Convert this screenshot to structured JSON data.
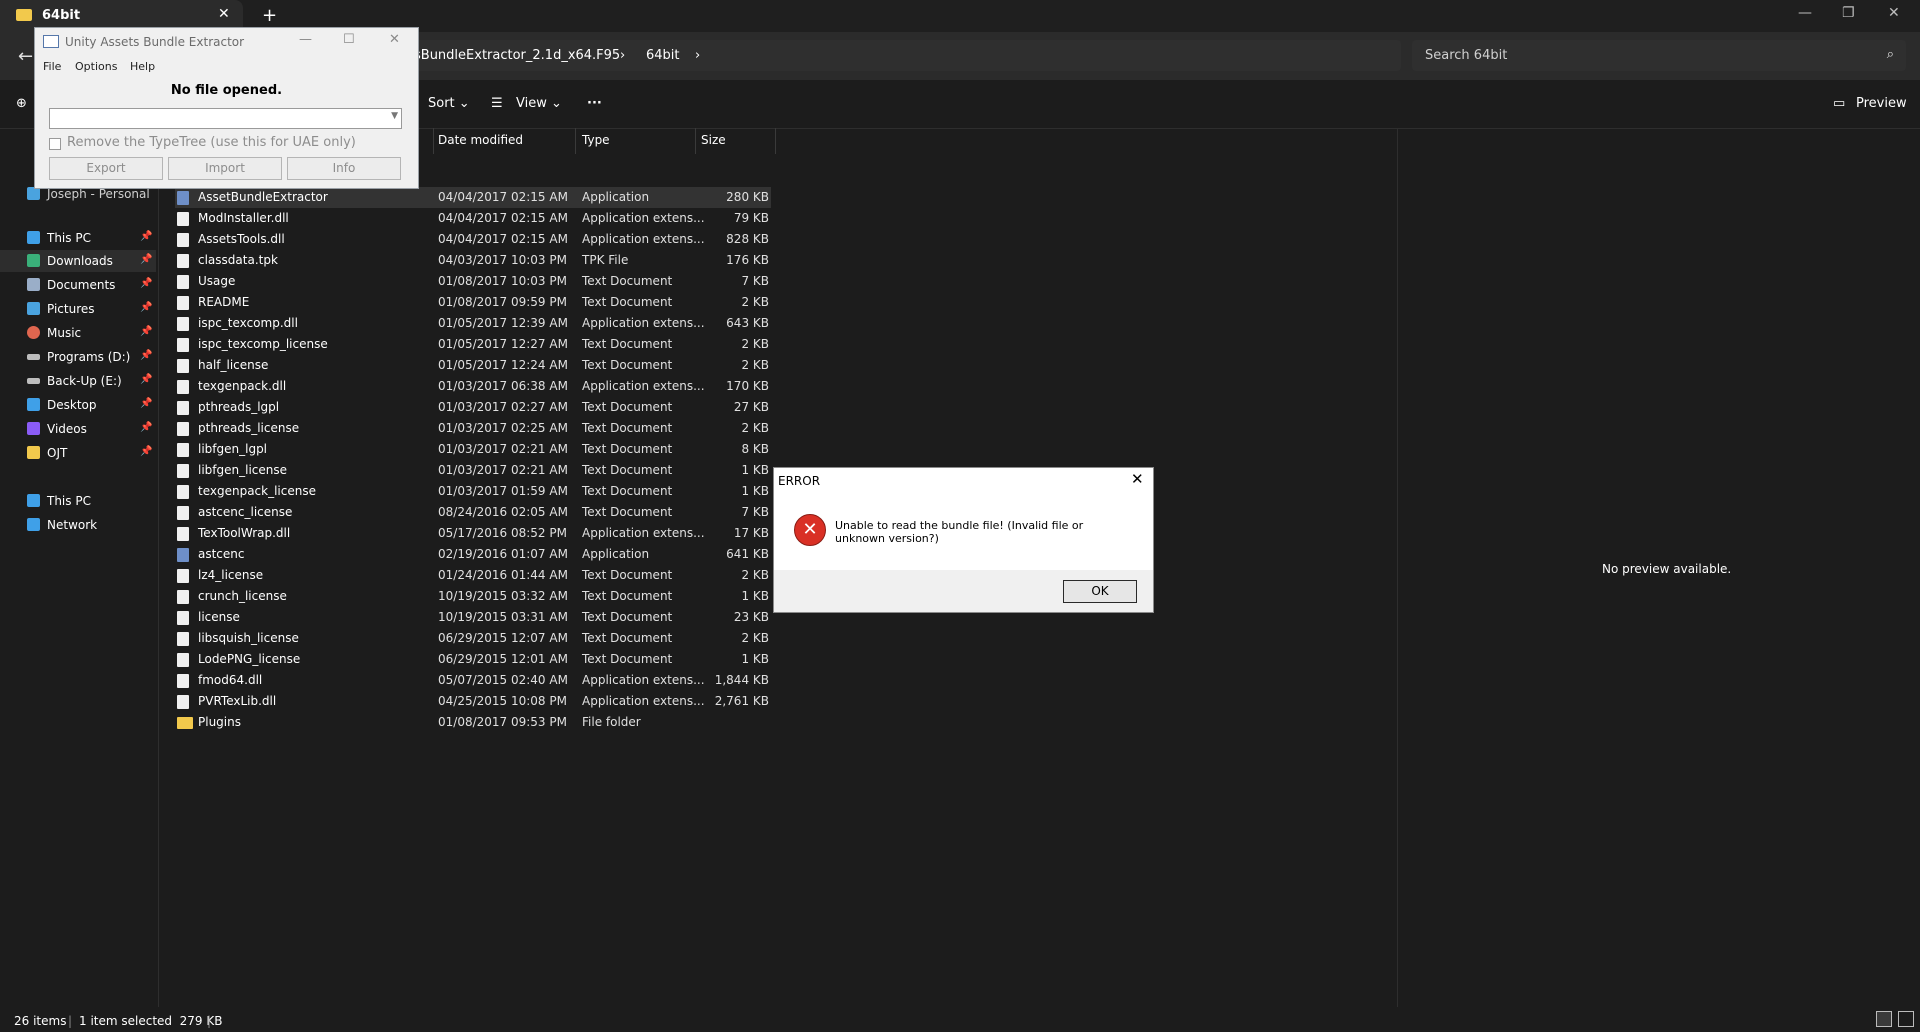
{
  "explorer": {
    "tab_title": "64bit",
    "tab_close": "✕",
    "new_tab": "+",
    "breadcrumb": [
      "sBundleExtractor_2.1d_x64.F95",
      "64bit"
    ],
    "search_placeholder": "Search 64bit",
    "toolbar": {
      "sort": "Sort",
      "view": "View",
      "more": "···",
      "preview": "Preview"
    },
    "columns": {
      "date": "Date modified",
      "type": "Type",
      "size": "Size"
    },
    "nav": [
      {
        "label": "Joseph - Personal",
        "icon": "cloud-icon",
        "color": "#4aa3df"
      },
      {
        "label": "This PC",
        "icon": "pc-icon",
        "color": "#3fa0e8"
      },
      {
        "label": "Downloads",
        "icon": "download-icon",
        "color": "#3ab07a"
      },
      {
        "label": "Documents",
        "icon": "documents-icon",
        "color": "#9aaec8"
      },
      {
        "label": "Pictures",
        "icon": "pictures-icon",
        "color": "#4aa3df"
      },
      {
        "label": "Music",
        "icon": "music-icon",
        "color": "#e0664f"
      },
      {
        "label": "Programs (D:)",
        "icon": "drive-icon",
        "color": "#bdbdbd"
      },
      {
        "label": "Back-Up (E:)",
        "icon": "drive-icon",
        "color": "#bdbdbd"
      },
      {
        "label": "Desktop",
        "icon": "desktop-icon",
        "color": "#3fa0e8"
      },
      {
        "label": "Videos",
        "icon": "videos-icon",
        "color": "#8b5cf6"
      },
      {
        "label": "OJT",
        "icon": "folder-icon",
        "color": "#f2c94c"
      },
      {
        "label": "This PC",
        "icon": "pc-icon",
        "color": "#3fa0e8"
      },
      {
        "label": "Network",
        "icon": "network-icon",
        "color": "#3fa0e8"
      }
    ],
    "files": [
      {
        "name": "AssetBundleExtractor",
        "date": "04/04/2017 02:15 AM",
        "type": "Application",
        "size": "280 KB",
        "kind": "app"
      },
      {
        "name": "ModInstaller.dll",
        "date": "04/04/2017 02:15 AM",
        "type": "Application extens...",
        "size": "79 KB",
        "kind": "file"
      },
      {
        "name": "AssetsTools.dll",
        "date": "04/04/2017 02:15 AM",
        "type": "Application extens...",
        "size": "828 KB",
        "kind": "file"
      },
      {
        "name": "classdata.tpk",
        "date": "04/03/2017 10:03 PM",
        "type": "TPK File",
        "size": "176 KB",
        "kind": "file"
      },
      {
        "name": "Usage",
        "date": "01/08/2017 10:03 PM",
        "type": "Text Document",
        "size": "7 KB",
        "kind": "file"
      },
      {
        "name": "README",
        "date": "01/08/2017 09:59 PM",
        "type": "Text Document",
        "size": "2 KB",
        "kind": "file"
      },
      {
        "name": "ispc_texcomp.dll",
        "date": "01/05/2017 12:39 AM",
        "type": "Application extens...",
        "size": "643 KB",
        "kind": "file"
      },
      {
        "name": "ispc_texcomp_license",
        "date": "01/05/2017 12:27 AM",
        "type": "Text Document",
        "size": "2 KB",
        "kind": "file"
      },
      {
        "name": "half_license",
        "date": "01/05/2017 12:24 AM",
        "type": "Text Document",
        "size": "2 KB",
        "kind": "file"
      },
      {
        "name": "texgenpack.dll",
        "date": "01/03/2017 06:38 AM",
        "type": "Application extens...",
        "size": "170 KB",
        "kind": "file"
      },
      {
        "name": "pthreads_lgpl",
        "date": "01/03/2017 02:27 AM",
        "type": "Text Document",
        "size": "27 KB",
        "kind": "file"
      },
      {
        "name": "pthreads_license",
        "date": "01/03/2017 02:25 AM",
        "type": "Text Document",
        "size": "2 KB",
        "kind": "file"
      },
      {
        "name": "libfgen_lgpl",
        "date": "01/03/2017 02:21 AM",
        "type": "Text Document",
        "size": "8 KB",
        "kind": "file"
      },
      {
        "name": "libfgen_license",
        "date": "01/03/2017 02:21 AM",
        "type": "Text Document",
        "size": "1 KB",
        "kind": "file"
      },
      {
        "name": "texgenpack_license",
        "date": "01/03/2017 01:59 AM",
        "type": "Text Document",
        "size": "1 KB",
        "kind": "file"
      },
      {
        "name": "astcenc_license",
        "date": "08/24/2016 02:05 AM",
        "type": "Text Document",
        "size": "7 KB",
        "kind": "file"
      },
      {
        "name": "TexToolWrap.dll",
        "date": "05/17/2016 08:52 PM",
        "type": "Application extens...",
        "size": "17 KB",
        "kind": "file"
      },
      {
        "name": "astcenc",
        "date": "02/19/2016 01:07 AM",
        "type": "Application",
        "size": "641 KB",
        "kind": "app"
      },
      {
        "name": "lz4_license",
        "date": "01/24/2016 01:44 AM",
        "type": "Text Document",
        "size": "2 KB",
        "kind": "file"
      },
      {
        "name": "crunch_license",
        "date": "10/19/2015 03:32 AM",
        "type": "Text Document",
        "size": "1 KB",
        "kind": "file"
      },
      {
        "name": "license",
        "date": "10/19/2015 03:31 AM",
        "type": "Text Document",
        "size": "23 KB",
        "kind": "file"
      },
      {
        "name": "libsquish_license",
        "date": "06/29/2015 12:07 AM",
        "type": "Text Document",
        "size": "2 KB",
        "kind": "file"
      },
      {
        "name": "LodePNG_license",
        "date": "06/29/2015 12:01 AM",
        "type": "Text Document",
        "size": "1 KB",
        "kind": "file"
      },
      {
        "name": "fmod64.dll",
        "date": "05/07/2015 02:40 AM",
        "type": "Application extens...",
        "size": "1,844 KB",
        "kind": "file"
      },
      {
        "name": "PVRTexLib.dll",
        "date": "04/25/2015 10:08 PM",
        "type": "Application extens...",
        "size": "2,761 KB",
        "kind": "file"
      },
      {
        "name": "Plugins",
        "date": "01/08/2017 09:53 PM",
        "type": "File folder",
        "size": "",
        "kind": "folder"
      }
    ],
    "preview_empty": "No preview available.",
    "status": {
      "items": "26 items",
      "selected": "1 item selected  279 KB"
    }
  },
  "uabe": {
    "title": "Unity Assets Bundle Extractor",
    "menu": [
      "File",
      "Options",
      "Help"
    ],
    "status": "No file opened.",
    "typetree_checkbox": "Remove the TypeTree (use this for UAE only)",
    "buttons": [
      "Export",
      "Import",
      "Info"
    ]
  },
  "error_dialog": {
    "title": "ERROR",
    "message": "Unable to read the bundle file! (Invalid file or unknown version?)",
    "ok": "OK"
  }
}
